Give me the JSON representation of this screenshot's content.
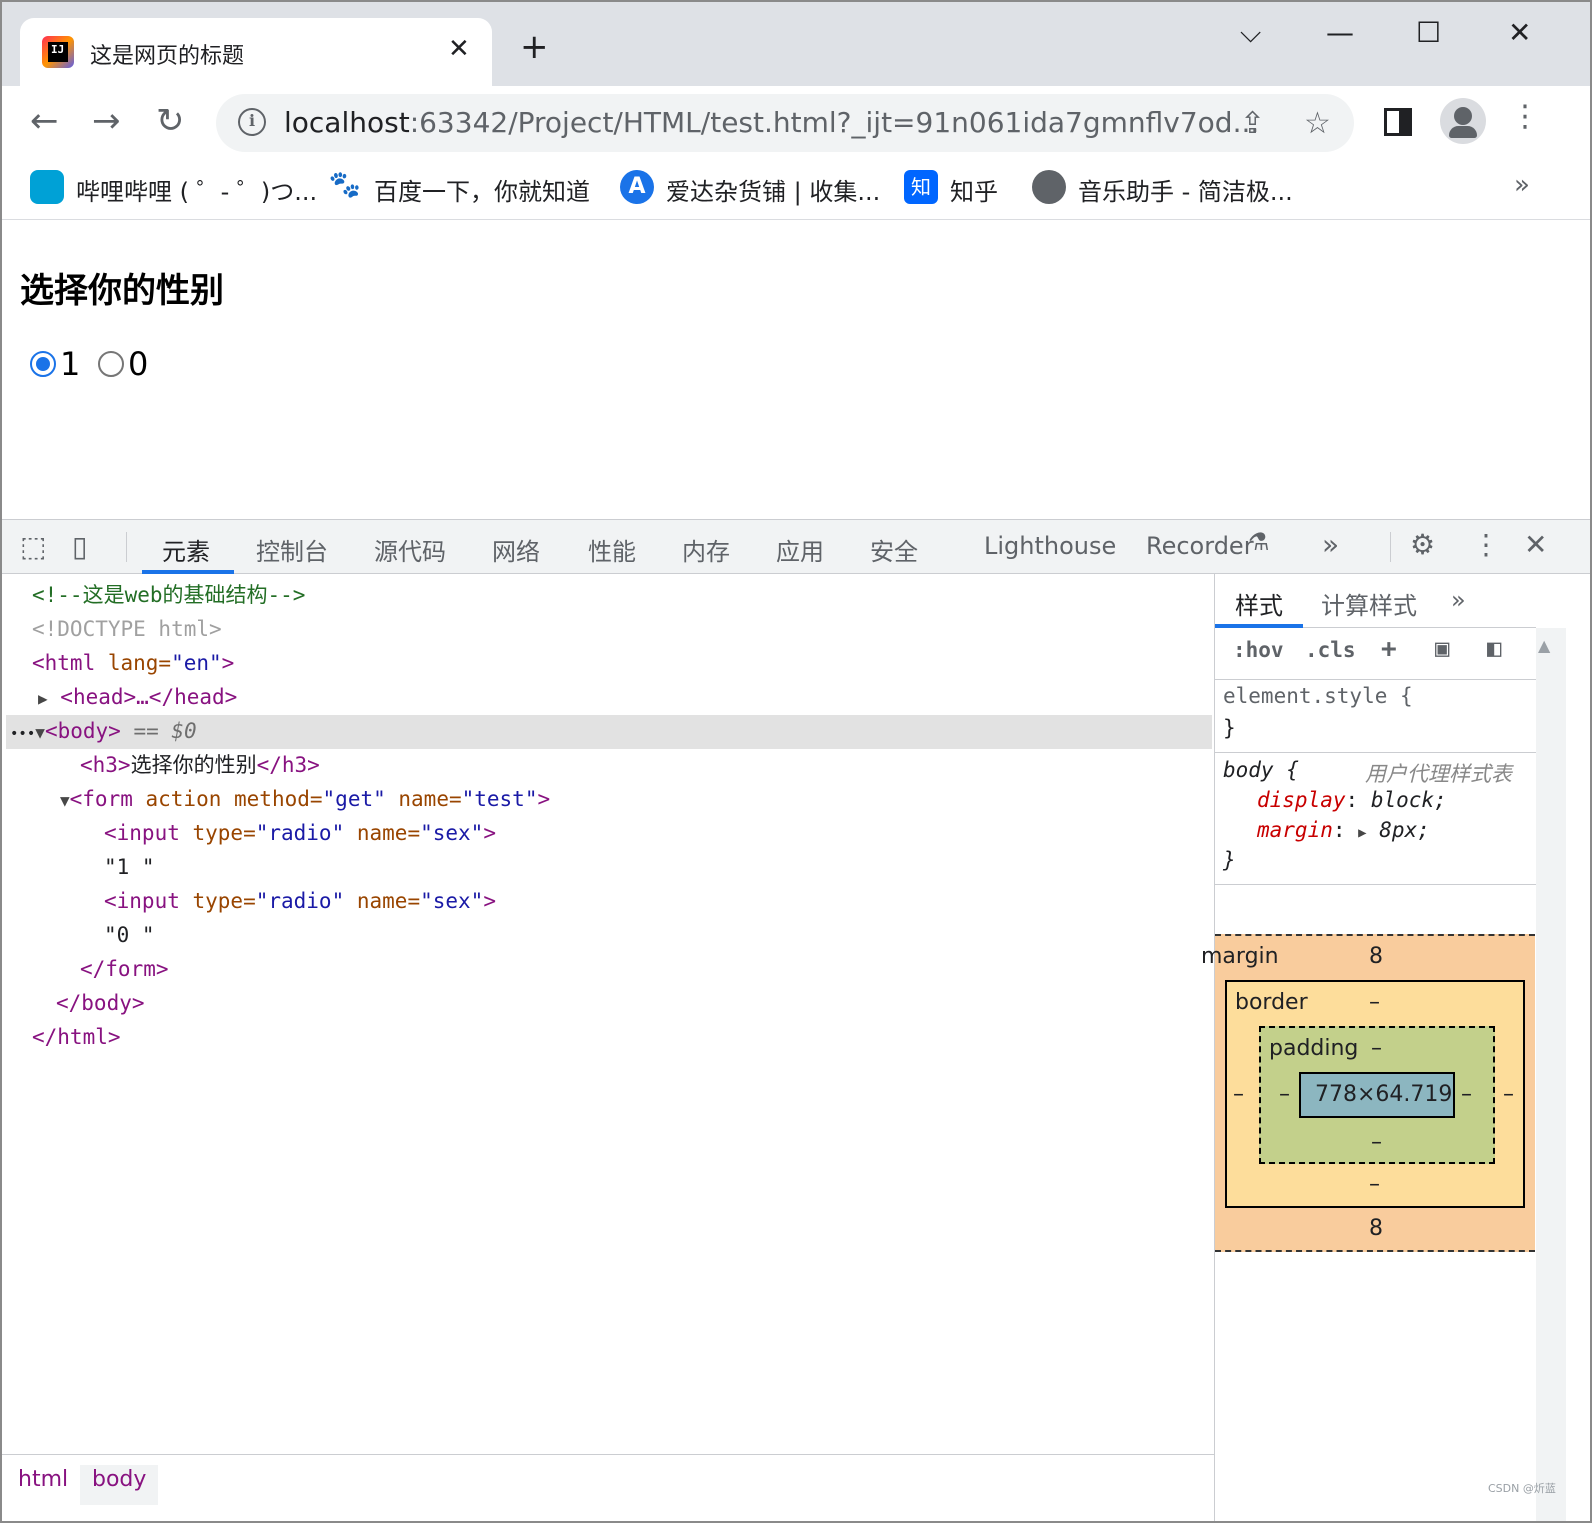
{
  "tab": {
    "title": "这是网页的标题",
    "close": "✕"
  },
  "window_controls": {
    "dropdown": "⌵",
    "minimize": "—",
    "maximize": "☐",
    "close": "✕"
  },
  "toolbar": {
    "url_host": "localhost",
    "url_rest": ":63342/Project/HTML/test.html?_ijt=91n061ida7gmnflv7od..."
  },
  "bookmarks": [
    {
      "label": "哔哩哔哩 ( ゜- ゜)つ...",
      "icon": "bilibili-icon",
      "color": "#00a1d6"
    },
    {
      "label": "百度一下，你就知道",
      "icon": "baidu-icon",
      "color": "#2932e1"
    },
    {
      "label": "爱达杂货铺 | 收集...",
      "icon": "aida-icon",
      "color": "#1a73e8"
    },
    {
      "label": "知乎",
      "icon": "zhihu-icon",
      "color": "#0066ff"
    },
    {
      "label": "音乐助手 - 简洁极...",
      "icon": "globe-icon",
      "color": "#5f6368"
    }
  ],
  "page": {
    "heading": "选择你的性别",
    "radios": [
      {
        "label": "1",
        "checked": true
      },
      {
        "label": "0",
        "checked": false
      }
    ]
  },
  "devtools": {
    "tabs": [
      "元素",
      "控制台",
      "源代码",
      "网络",
      "性能",
      "内存",
      "应用",
      "安全",
      "Lighthouse",
      "Recorder"
    ],
    "active_tab": "元素",
    "code": {
      "comment": "<!--这是web的基础结构-->",
      "doctype": "<!DOCTYPE html>",
      "html_open": "<html",
      "lang_attr": " lang=",
      "lang_val": "\"en\"",
      "close_angle": ">",
      "head": "<head>…</head>",
      "body_open": "<body>",
      "body_ref": " == $0",
      "h3_open": "<h3>",
      "h3_text": "选择你的性别",
      "h3_close": "</h3>",
      "form_open": "<form",
      "form_action": " action",
      "form_method_attr": " method=",
      "form_method_val": "\"get\"",
      "form_name_attr": " name=",
      "form_name_val": "\"test\"",
      "input_open": "<input",
      "type_attr": " type=",
      "type_val": "\"radio\"",
      "name_attr": " name=",
      "name_val": "\"sex\"",
      "text1": "\"1 \"",
      "text0": "\"0 \"",
      "form_close": "</form>",
      "body_close": "</body>",
      "html_close": "</html>",
      "dots": "•••"
    },
    "breadcrumbs": [
      "html",
      "body"
    ],
    "styles": {
      "tabs": [
        "样式",
        "计算样式"
      ],
      "hov": ":hov",
      "cls": ".cls",
      "element_style": "element.style {",
      "close_brace": "}",
      "body_selector": "body {",
      "ua_label": "用户代理样式表",
      "display_prop": "display",
      "display_val": "block;",
      "margin_prop": "margin",
      "margin_val": "8px;"
    },
    "box_model": {
      "margin_label": "margin",
      "margin_top": "8",
      "margin_bottom": "8",
      "border_label": "border",
      "border_val": "–",
      "padding_label": "padding",
      "padding_val": "–",
      "content_size": "778×64.719"
    }
  },
  "watermark": "CSDN @炘蓝"
}
